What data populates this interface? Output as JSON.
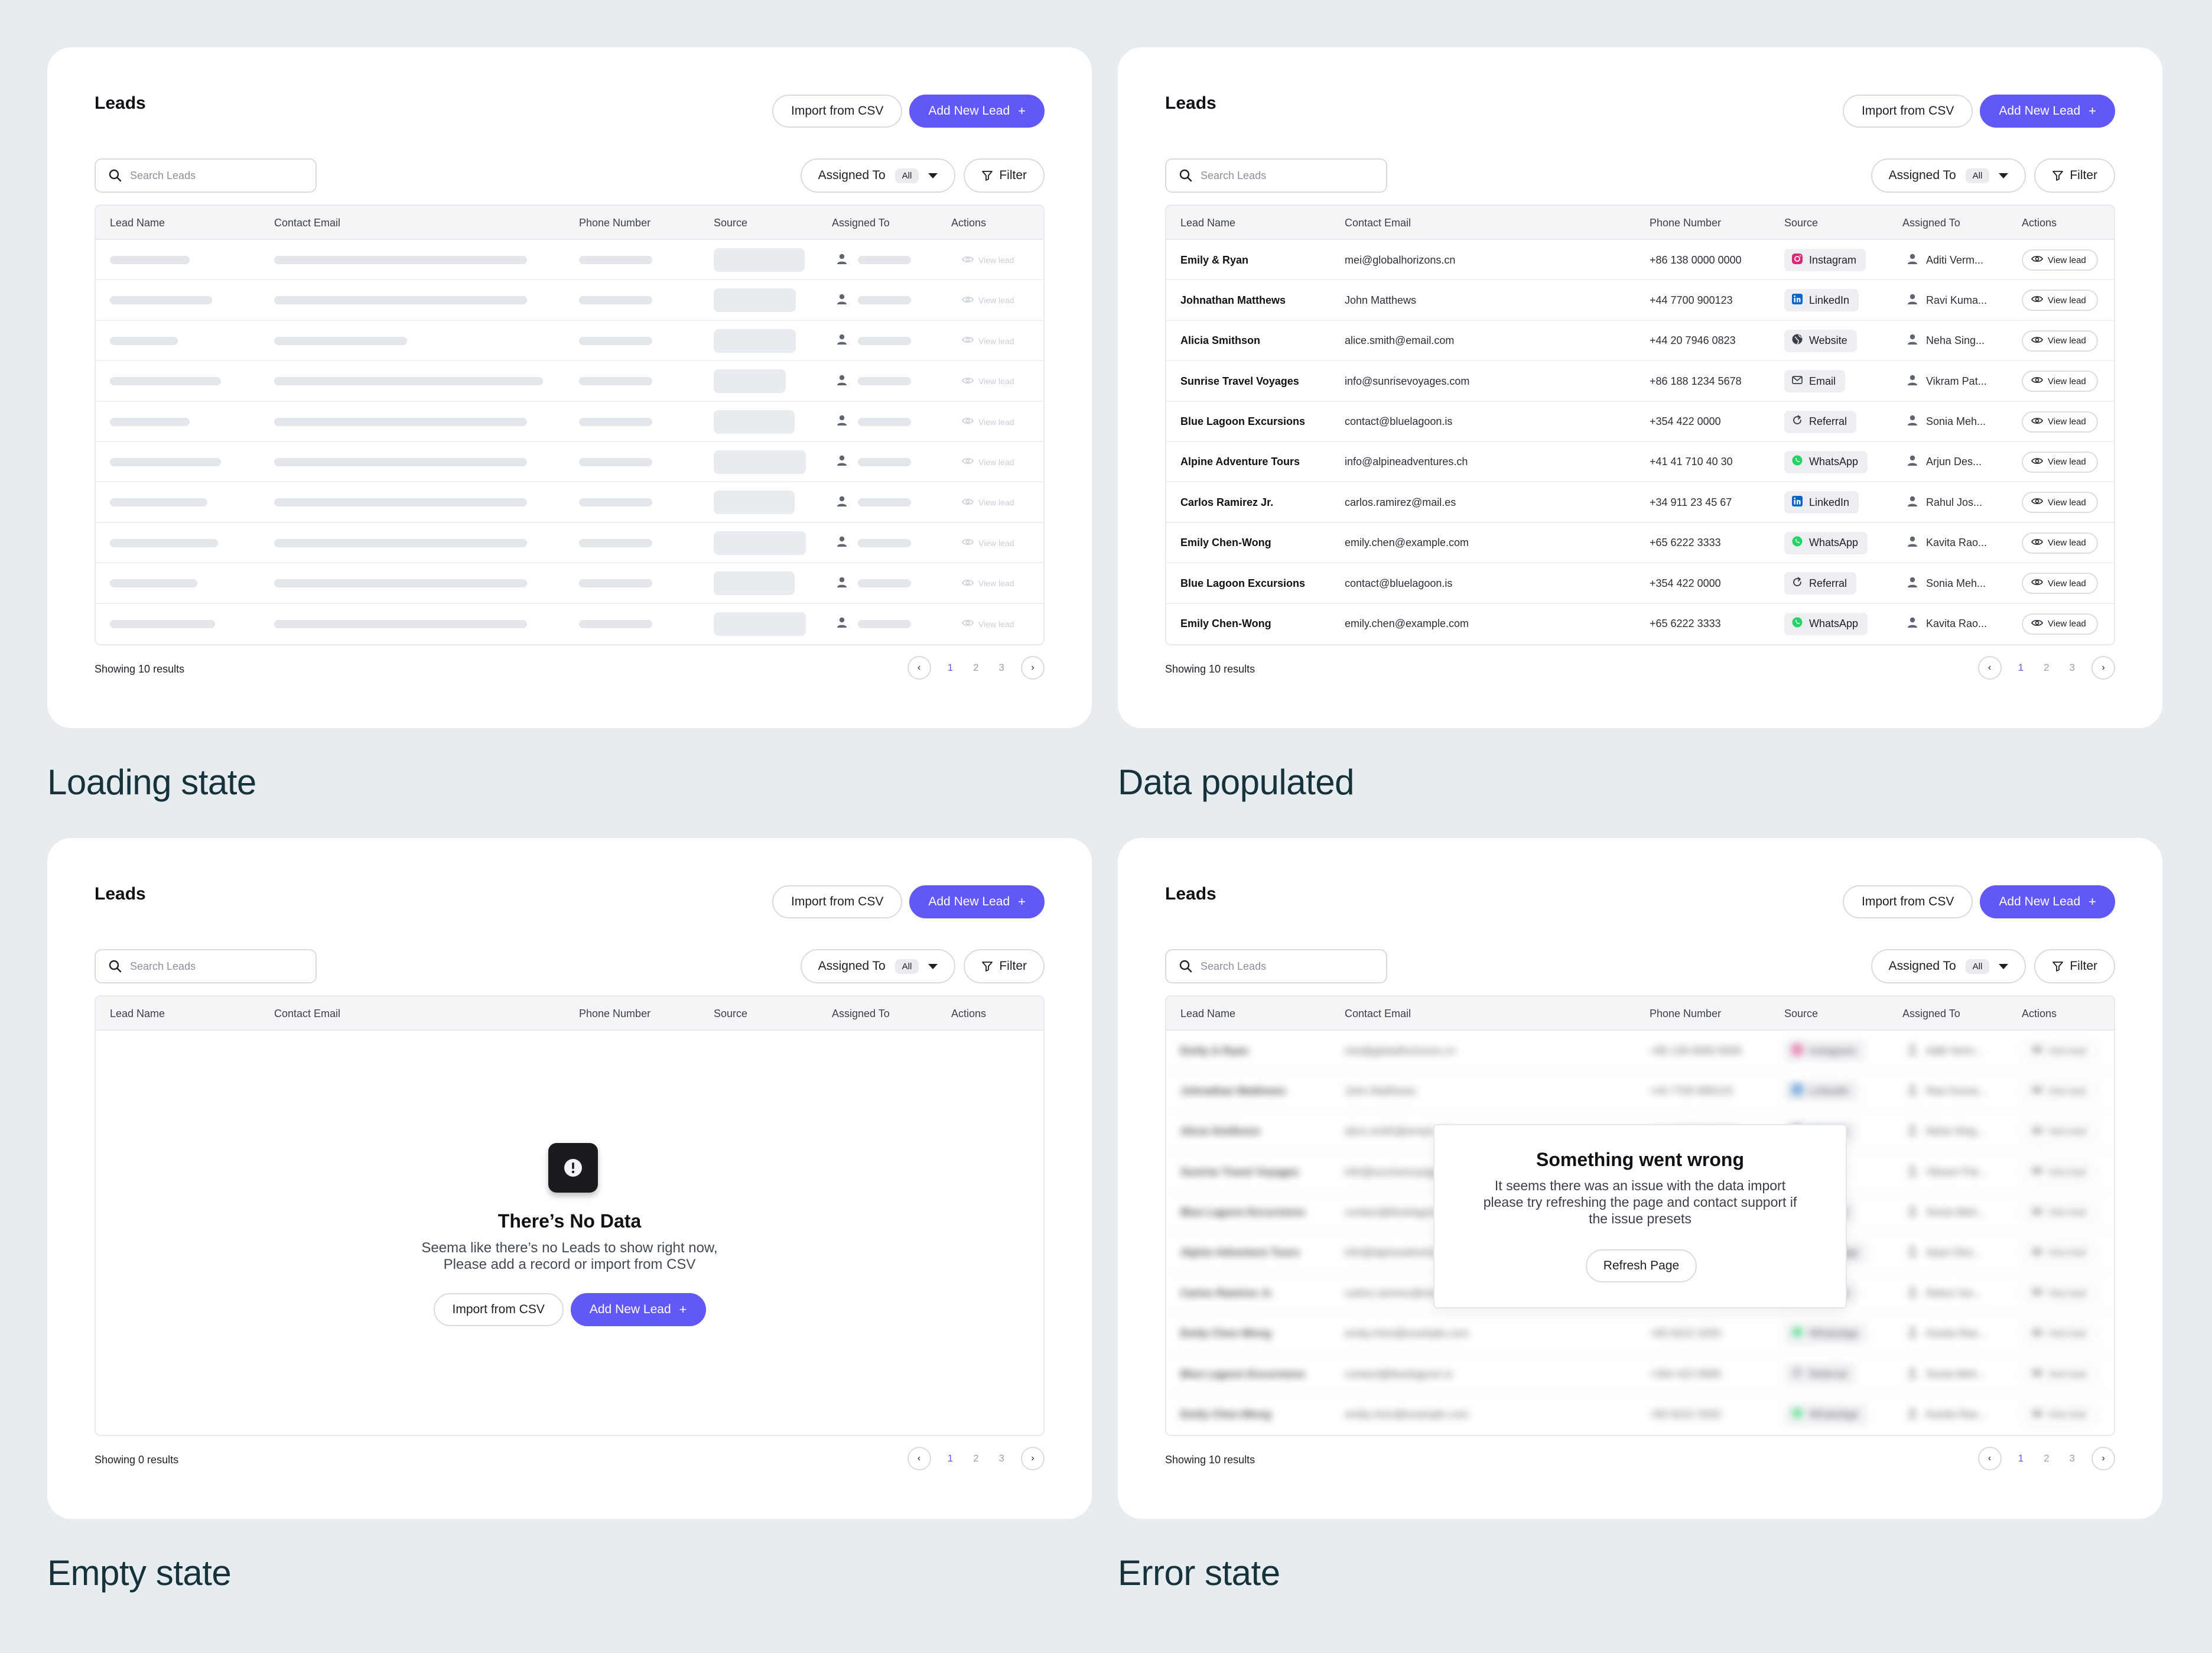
{
  "common": {
    "title": "Leads",
    "import_label": "Import from CSV",
    "add_label": "Add New Lead",
    "add_plus": "+",
    "search_placeholder": "Search Leads",
    "assigned_label": "Assigned To",
    "assigned_value": "All",
    "filter_label": "Filter",
    "columns": [
      "Lead Name",
      "Contact Email",
      "Phone Number",
      "Source",
      "Assigned To",
      "Actions"
    ],
    "view_label": "View lead",
    "pages": [
      "1",
      "2",
      "3"
    ],
    "prev_glyph": "‹",
    "next_glyph": "›"
  },
  "loading": {
    "caption": "Loading state",
    "results": "Showing 10 results",
    "rows": [
      {
        "name": 0.54,
        "email": 0.93,
        "phone": 0.73,
        "source": 0.67
      },
      {
        "name": 0.69,
        "email": 0.93,
        "phone": 0.73,
        "source": 0.58
      },
      {
        "name": 0.46,
        "email": 0.49,
        "phone": 0.73,
        "source": 0.58
      },
      {
        "name": 0.75,
        "email": 0.99,
        "phone": 0.73,
        "source": 0.48
      },
      {
        "name": 0.54,
        "email": 0.93,
        "phone": 0.73,
        "source": 0.57
      },
      {
        "name": 0.75,
        "email": 0.93,
        "phone": 0.73,
        "source": 0.68
      },
      {
        "name": 0.66,
        "email": 0.93,
        "phone": 0.73,
        "source": 0.57
      },
      {
        "name": 0.73,
        "email": 0.93,
        "phone": 0.73,
        "source": 0.68
      },
      {
        "name": 0.59,
        "email": 0.93,
        "phone": 0.73,
        "source": 0.57
      },
      {
        "name": 0.71,
        "email": 0.93,
        "phone": 0.73,
        "source": 0.68
      }
    ]
  },
  "populated": {
    "caption": "Data populated",
    "results": "Showing 10 results",
    "rows": [
      {
        "name": "Emily & Ryan",
        "email": "mei@globalhorizons.cn",
        "phone": "+86 138 0000 0000",
        "source": "Instagram",
        "source_icon": "instagram-icon",
        "assigned": "Aditi Verm..."
      },
      {
        "name": "Johnathan Matthews",
        "email": "John Matthews",
        "phone": "+44 7700 900123",
        "source": "LinkedIn",
        "source_icon": "linkedin-icon",
        "assigned": "Ravi Kuma..."
      },
      {
        "name": "Alicia Smithson",
        "email": "alice.smith@email.com",
        "phone": "+44 20 7946 0823",
        "source": "Website",
        "source_icon": "globe-icon",
        "assigned": "Neha Sing..."
      },
      {
        "name": "Sunrise Travel Voyages",
        "email": "info@sunrisevoyages.com",
        "phone": "+86 188 1234 5678",
        "source": "Email",
        "source_icon": "mail-icon",
        "assigned": "Vikram Pat..."
      },
      {
        "name": "Blue Lagoon Excursions",
        "email": "contact@bluelagoon.is",
        "phone": "+354 422 0000",
        "source": "Referral",
        "source_icon": "referral-icon",
        "assigned": "Sonia Meh..."
      },
      {
        "name": "Alpine Adventure Tours",
        "email": "info@alpineadventures.ch",
        "phone": "+41 41 710 40 30",
        "source": "WhatsApp",
        "source_icon": "whatsapp-icon",
        "assigned": "Arjun Des..."
      },
      {
        "name": "Carlos Ramirez Jr.",
        "email": "carlos.ramirez@mail.es",
        "phone": "+34 911 23 45 67",
        "source": "LinkedIn",
        "source_icon": "linkedin-icon",
        "assigned": "Rahul Jos..."
      },
      {
        "name": "Emily Chen-Wong",
        "email": "emily.chen@example.com",
        "phone": "+65 6222 3333",
        "source": "WhatsApp",
        "source_icon": "whatsapp-icon",
        "assigned": "Kavita Rao..."
      },
      {
        "name": "Blue Lagoon Excursions",
        "email": "contact@bluelagoon.is",
        "phone": "+354 422 0000",
        "source": "Referral",
        "source_icon": "referral-icon",
        "assigned": "Sonia Meh..."
      },
      {
        "name": "Emily Chen-Wong",
        "email": "emily.chen@example.com",
        "phone": "+65 6222 3333",
        "source": "WhatsApp",
        "source_icon": "whatsapp-icon",
        "assigned": "Kavita Rao..."
      }
    ]
  },
  "empty": {
    "caption": "Empty state",
    "results": "Showing 0 results",
    "icon": "alert-icon",
    "title": "There’s No Data",
    "desc_line1": "Seema like there’s no Leads to show right now,",
    "desc_line2": "Please add a record or import from CSV"
  },
  "error": {
    "caption": "Error state",
    "results": "Showing 10 results",
    "title": "Something went wrong",
    "desc_line1": "It seems there was an issue with the data import",
    "desc_line2": "please try refreshing the page and contact support if",
    "desc_line3": "the issue presets",
    "refresh_label": "Refresh Page"
  },
  "colors": {
    "accent": "#6258f5",
    "background": "#e6ecef",
    "instagram": "#d62976",
    "linkedin": "#0a66c2",
    "whatsapp": "#25d366"
  }
}
